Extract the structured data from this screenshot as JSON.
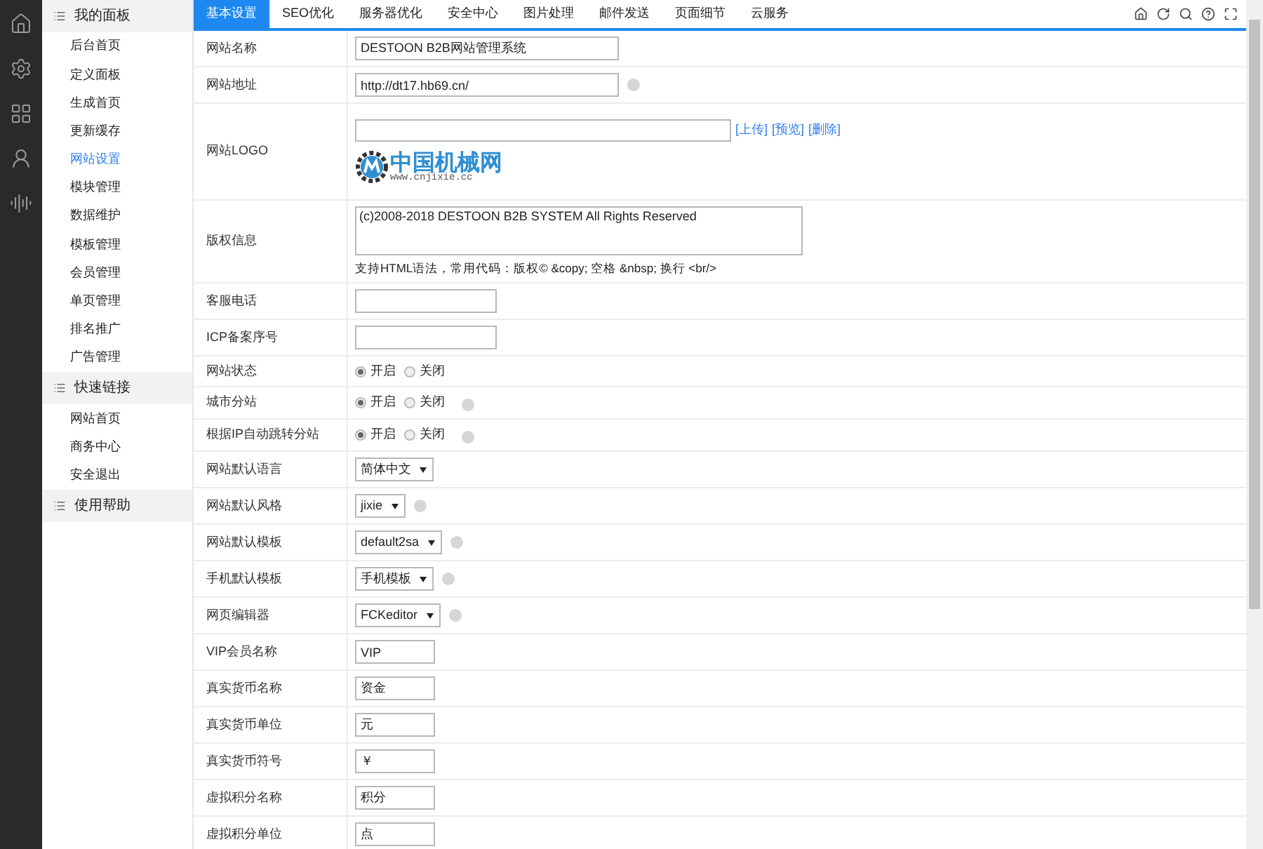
{
  "sidebar": {
    "groups": [
      {
        "title": "我的面板",
        "items": [
          {
            "label": "后台首页",
            "selected": false
          },
          {
            "label": "定义面板",
            "selected": false
          },
          {
            "label": "生成首页",
            "selected": false
          },
          {
            "label": "更新缓存",
            "selected": false
          },
          {
            "label": "网站设置",
            "selected": true
          },
          {
            "label": "模块管理",
            "selected": false
          },
          {
            "label": "数据维护",
            "selected": false
          },
          {
            "label": "模板管理",
            "selected": false
          },
          {
            "label": "会员管理",
            "selected": false
          },
          {
            "label": "单页管理",
            "selected": false
          },
          {
            "label": "排名推广",
            "selected": false
          },
          {
            "label": "广告管理",
            "selected": false
          }
        ]
      },
      {
        "title": "快速链接",
        "items": [
          {
            "label": "网站首页",
            "selected": false
          },
          {
            "label": "商务中心",
            "selected": false
          },
          {
            "label": "安全退出",
            "selected": false
          }
        ]
      },
      {
        "title": "使用帮助"
      }
    ]
  },
  "tabs": [
    {
      "label": "基本设置",
      "selected": true
    },
    {
      "label": "SEO优化",
      "selected": false
    },
    {
      "label": "服务器优化",
      "selected": false
    },
    {
      "label": "安全中心",
      "selected": false
    },
    {
      "label": "图片处理",
      "selected": false
    },
    {
      "label": "邮件发送",
      "selected": false
    },
    {
      "label": "页面细节",
      "selected": false
    },
    {
      "label": "云服务",
      "selected": false
    }
  ],
  "form": [
    {
      "kind": "text_wide",
      "label": "网站名称",
      "value": "DESTOON B2B网站管理系统",
      "help": false
    },
    {
      "kind": "text_wide",
      "label": "网站地址",
      "value": "http://dt17.hb69.cn/",
      "help": true
    },
    {
      "kind": "logo",
      "label": "网站LOGO",
      "links": [
        "[上传]",
        "[预览]",
        "[删除]"
      ],
      "logo_title": "中国机械网",
      "logo_url": "www.cnjixie.cc"
    },
    {
      "kind": "textarea",
      "label": "版权信息",
      "value": "(c)2008-2018 DESTOON B2B SYSTEM All Rights Reserved",
      "note": "支持HTML语法，常用代码：版权© &copy; 空格 &nbsp; 换行 <br/>"
    },
    {
      "kind": "text_medium",
      "label": "客服电话",
      "help": false
    },
    {
      "kind": "text_medium",
      "label": "ICP备案序号",
      "help": false
    },
    {
      "kind": "radio",
      "label": "网站状态",
      "options": [
        {
          "label": "开启",
          "selected": true
        },
        {
          "label": "关闭",
          "selected": false
        }
      ],
      "help": false
    },
    {
      "kind": "radio",
      "label": "城市分站",
      "options": [
        {
          "label": "开启",
          "selected": true
        },
        {
          "label": "关闭",
          "selected": false
        }
      ],
      "help": true
    },
    {
      "kind": "radio",
      "label": "根据IP自动跳转分站",
      "options": [
        {
          "label": "开启",
          "selected": true
        },
        {
          "label": "关闭",
          "selected": false
        }
      ],
      "help": true
    },
    {
      "kind": "select",
      "label": "网站默认语言",
      "value": "简体中文",
      "help": false
    },
    {
      "kind": "select",
      "label": "网站默认风格",
      "value": "jixie",
      "help": true
    },
    {
      "kind": "select",
      "label": "网站默认模板",
      "value": "default2sa",
      "help": true
    },
    {
      "kind": "select",
      "label": "手机默认模板",
      "value": "手机模板",
      "help": true
    },
    {
      "kind": "select",
      "label": "网页编辑器",
      "value": "FCKeditor",
      "help": true
    },
    {
      "kind": "text_small",
      "label": "VIP会员名称",
      "value": "VIP",
      "help": false
    },
    {
      "kind": "text_small",
      "label": "真实货币名称",
      "value": "资金",
      "help": false
    },
    {
      "kind": "text_small",
      "label": "真实货币单位",
      "value": "元",
      "help": false
    },
    {
      "kind": "text_small",
      "label": "真实货币符号",
      "value": "￥",
      "help": false
    },
    {
      "kind": "text_small",
      "label": "虚拟积分名称",
      "value": "积分",
      "help": false
    },
    {
      "kind": "text_small",
      "label": "虚拟积分单位",
      "value": "点",
      "help": false
    }
  ]
}
